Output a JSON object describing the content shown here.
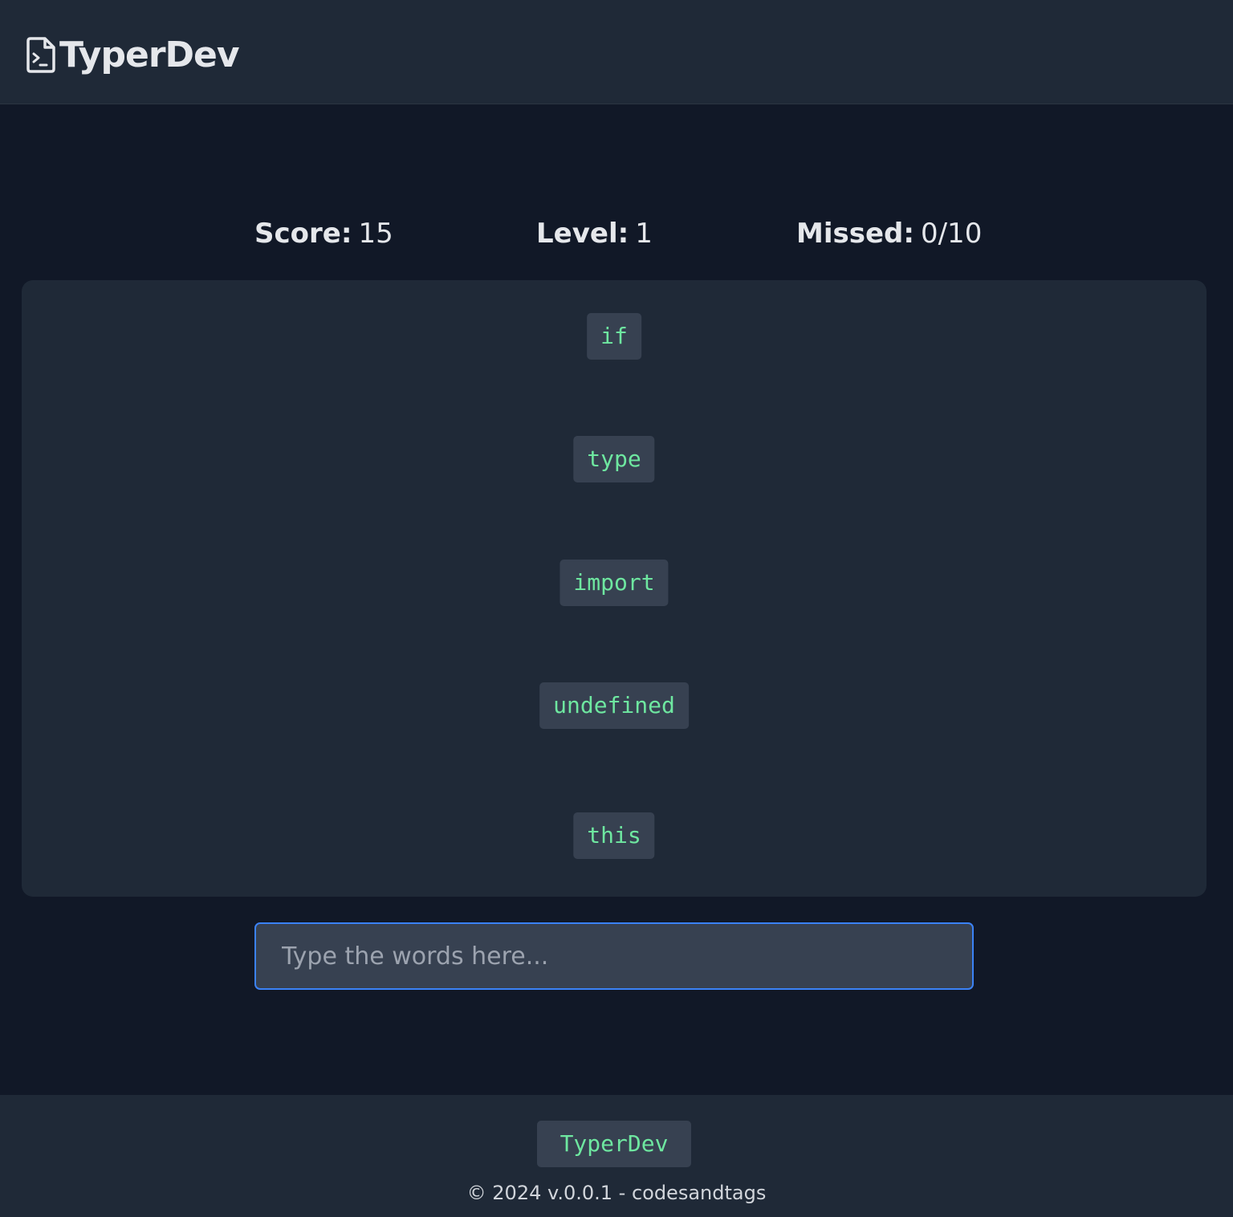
{
  "header": {
    "app_title": "TyperDev",
    "logo_icon": "terminal-file-icon"
  },
  "stats": {
    "score_label": "Score:",
    "score_value": "15",
    "level_label": "Level:",
    "level_value": "1",
    "missed_label": "Missed:",
    "missed_value": "0/10"
  },
  "board": {
    "words": [
      "if",
      "type",
      "import",
      "undefined",
      "this"
    ]
  },
  "input": {
    "placeholder": "Type the words here...",
    "value": ""
  },
  "footer": {
    "badge": "TyperDev",
    "copyright": "© 2024 v.0.0.1 - codesandtags"
  },
  "colors": {
    "background": "#111827",
    "panel": "#1f2937",
    "chip": "#374151",
    "word_text": "#6ee7a0",
    "input_border": "#3b82f6"
  }
}
